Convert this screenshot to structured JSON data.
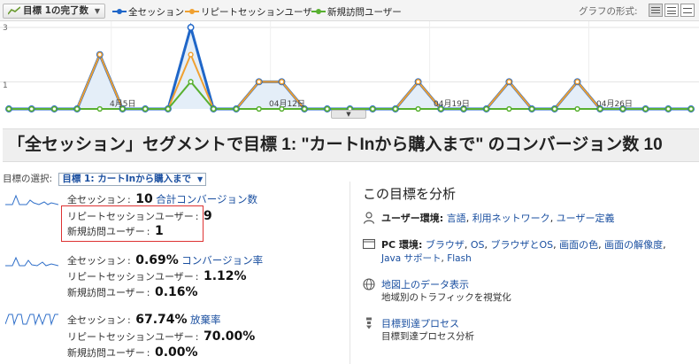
{
  "toolbar": {
    "metric_button": "目標 1の完了数",
    "legend": [
      {
        "label": "全セッション",
        "color": "#1f66c8"
      },
      {
        "label": "リピートセッションユーザー",
        "color": "#f0a030"
      },
      {
        "label": "新規訪問ユーザー",
        "color": "#58b030"
      }
    ],
    "graph_type_label": "グラフの形式:"
  },
  "chart_data": {
    "type": "line",
    "ylim": [
      0,
      3
    ],
    "y_ticks": [
      "3",
      "1"
    ],
    "x_tick_labels": [
      "4月5日",
      "04月12日",
      "04月19日",
      "04月26日"
    ],
    "x": [
      "4/1",
      "4/2",
      "4/3",
      "4/4",
      "4/5",
      "4/6",
      "4/7",
      "4/8",
      "4/9",
      "4/10",
      "4/11",
      "4/12",
      "4/13",
      "4/14",
      "4/15",
      "4/16",
      "4/17",
      "4/18",
      "4/19",
      "4/20",
      "4/21",
      "4/22",
      "4/23",
      "4/24",
      "4/25",
      "4/26",
      "4/27",
      "4/28",
      "4/29",
      "4/30",
      "5/1"
    ],
    "series": [
      {
        "name": "全セッション",
        "color": "#1f66c8",
        "values": [
          0,
          0,
          0,
          0,
          2,
          0,
          0,
          0,
          3,
          0,
          0,
          1,
          1,
          0,
          0,
          0,
          0,
          0,
          1,
          0,
          0,
          0,
          1,
          0,
          0,
          1,
          0,
          0,
          0,
          0,
          0
        ]
      },
      {
        "name": "リピートセッションユーザー",
        "color": "#f0a030",
        "values": [
          0,
          0,
          0,
          0,
          2,
          0,
          0,
          0,
          2,
          0,
          0,
          1,
          1,
          0,
          0,
          0,
          0,
          0,
          1,
          0,
          0,
          0,
          1,
          0,
          0,
          1,
          0,
          0,
          0,
          0,
          0
        ]
      },
      {
        "name": "新規訪問ユーザー",
        "color": "#58b030",
        "values": [
          0,
          0,
          0,
          0,
          0,
          0,
          0,
          0,
          1,
          0,
          0,
          0,
          0,
          0,
          0,
          0,
          0,
          0,
          0,
          0,
          0,
          0,
          0,
          0,
          0,
          0,
          0,
          0,
          0,
          0,
          0
        ]
      }
    ]
  },
  "title": "「全セッション」セグメントで目標 1: \"カートInから購入まで\" のコンバージョン数 10",
  "goal_select": {
    "label": "目標の選択:",
    "value": "目標 1: カートInから購入まで"
  },
  "metrics": {
    "conversions": {
      "all_label": "全セッション",
      "all_value": "10",
      "metric_link": "合計コンバージョン数",
      "repeat_label": "リピートセッションユーザー",
      "repeat_value": "9",
      "new_label": "新規訪問ユーザー",
      "new_value": "1"
    },
    "conversion_rate": {
      "all_label": "全セッション",
      "all_value": "0.69%",
      "metric_link": "コンバージョン率",
      "repeat_label": "リピートセッションユーザー",
      "repeat_value": "1.12%",
      "new_label": "新規訪問ユーザー",
      "new_value": "0.16%"
    },
    "abandon_rate": {
      "all_label": "全セッション",
      "all_value": "67.74%",
      "metric_link": "放棄率",
      "repeat_label": "リピートセッションユーザー",
      "repeat_value": "70.00%",
      "new_label": "新規訪問ユーザー",
      "new_value": "0.00%"
    }
  },
  "analyze": {
    "title": "この目標を分析",
    "user_env": {
      "label": "ユーザー環境:",
      "links": [
        "言語",
        "利用ネットワーク",
        "ユーザー定義"
      ]
    },
    "pc_env": {
      "label": "PC 環境:",
      "links": [
        "ブラウザ",
        "OS",
        "ブラウザとOS",
        "画面の色",
        "画面の解像度",
        "Java サポート",
        "Flash"
      ]
    },
    "map": {
      "link": "地図上のデータ表示",
      "desc": "地域別のトラフィックを視覚化"
    },
    "funnel": {
      "link": "目標到達プロセス",
      "desc": "目標到達プロセス分析"
    }
  }
}
